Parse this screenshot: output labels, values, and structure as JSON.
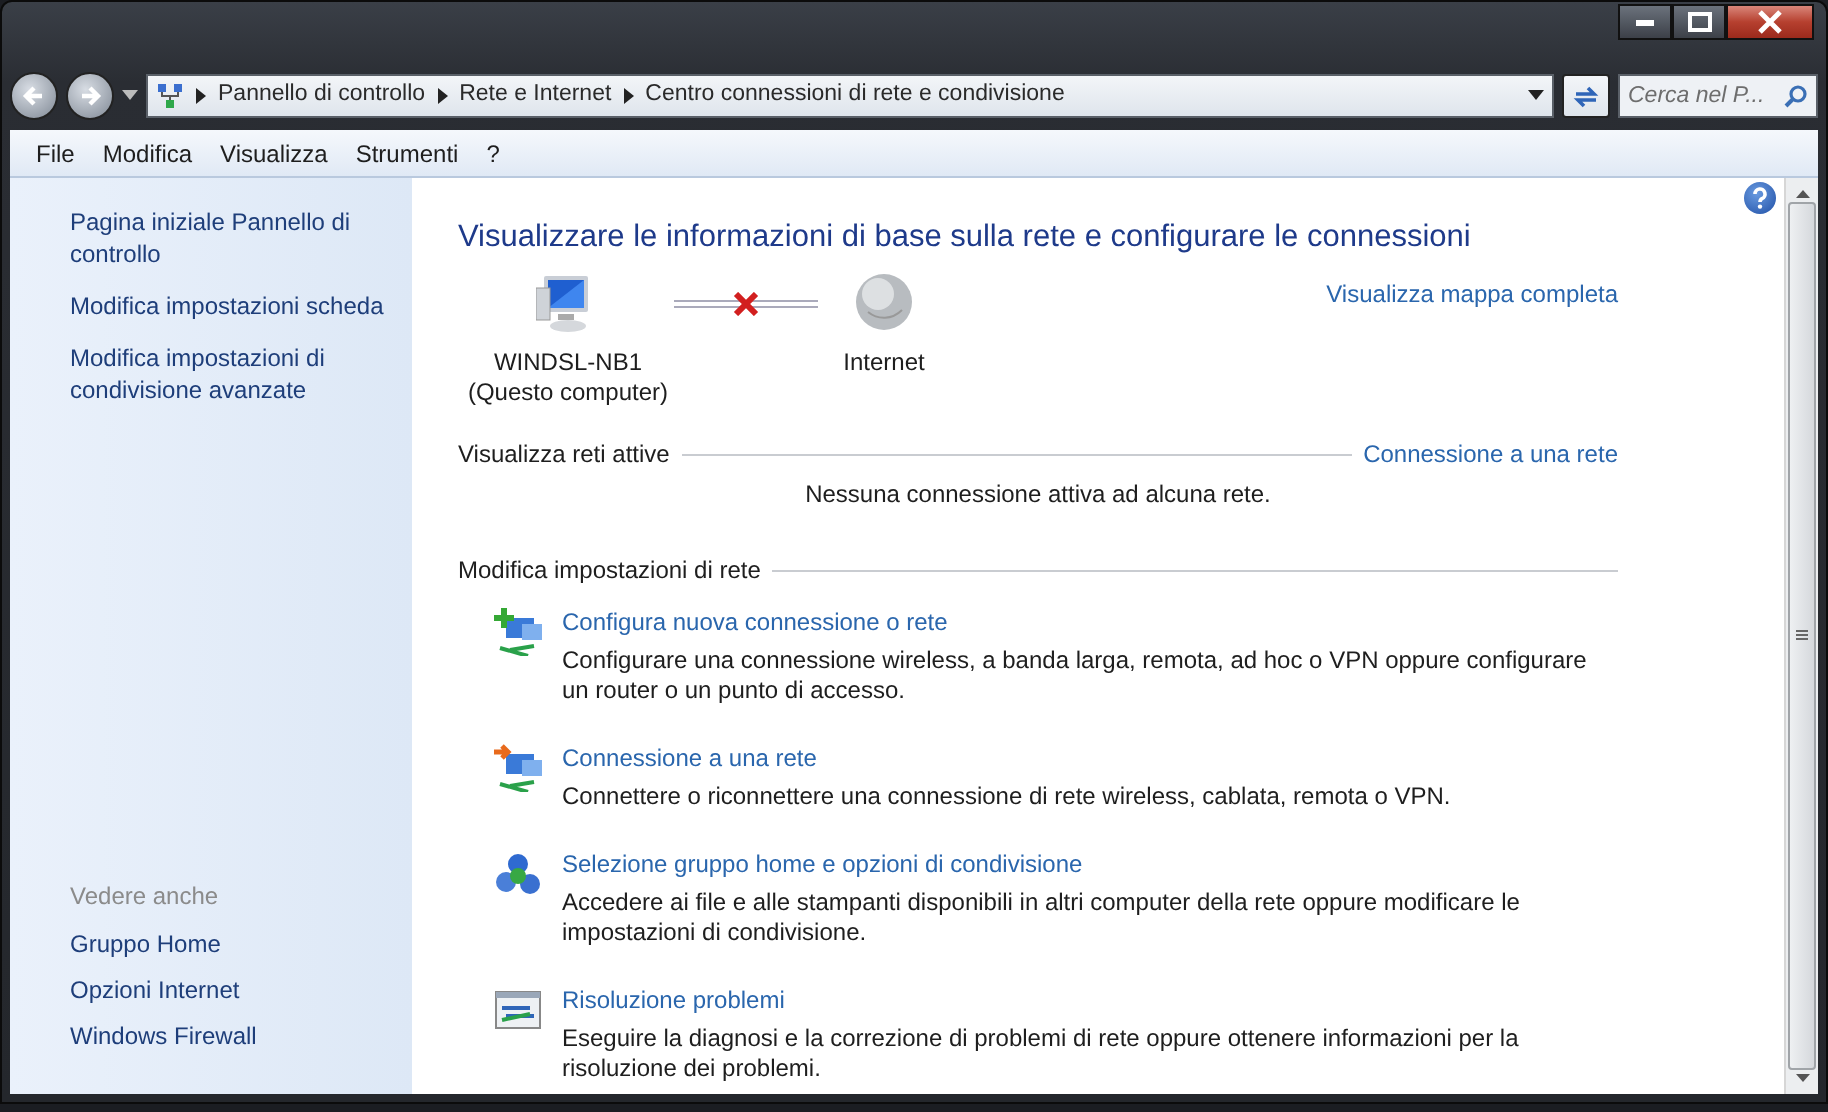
{
  "address_bar": {
    "breadcrumbs": [
      "Pannello di controllo",
      "Rete e Internet",
      "Centro connessioni di rete e condivisione"
    ]
  },
  "search": {
    "placeholder": "Cerca nel P..."
  },
  "menu": [
    "File",
    "Modifica",
    "Visualizza",
    "Strumenti",
    "?"
  ],
  "sidebar": {
    "links": [
      "Pagina iniziale Pannello di controllo",
      "Modifica impostazioni scheda",
      "Modifica impostazioni di condivisione avanzate"
    ],
    "see_also": {
      "heading": "Vedere anche",
      "links": [
        "Gruppo Home",
        "Opzioni Internet",
        "Windows Firewall"
      ]
    }
  },
  "main": {
    "title": "Visualizzare le informazioni di base sulla rete e configurare le connessioni",
    "map": {
      "nodes": [
        {
          "kind": "computer",
          "name": "WINDSL-NB1",
          "caption": "(Questo computer)"
        },
        {
          "kind": "globe",
          "name": "Internet"
        }
      ],
      "connected": false,
      "link": "Visualizza mappa completa"
    },
    "active_networks": {
      "heading": "Visualizza reti attive",
      "link": "Connessione a una rete",
      "message": "Nessuna connessione attiva ad alcuna rete."
    },
    "settings": {
      "heading": "Modifica impostazioni di rete",
      "tasks": [
        {
          "kind": "new-connection",
          "title": "Configura nuova connessione o rete",
          "description": "Configurare una connessione wireless, a banda larga, remota, ad hoc o VPN oppure configurare un router o un punto di accesso."
        },
        {
          "kind": "connect",
          "title": "Connessione a una rete",
          "description": "Connettere o riconnettere una connessione di rete wireless, cablata, remota o VPN."
        },
        {
          "kind": "homegroup",
          "title": "Selezione gruppo home e opzioni di condivisione",
          "description": "Accedere ai file e alle stampanti disponibili in altri computer della rete oppure modificare le impostazioni di condivisione."
        },
        {
          "kind": "troubleshoot",
          "title": "Risoluzione problemi",
          "description": "Eseguire la diagnosi e la correzione di problemi di rete oppure ottenere informazioni per la risoluzione dei problemi."
        }
      ]
    }
  }
}
